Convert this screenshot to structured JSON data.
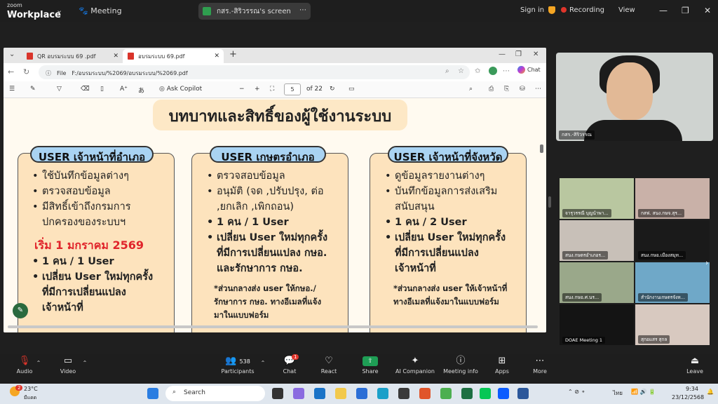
{
  "zoom": {
    "brand_small": "zoom",
    "brand": "Workplace",
    "meeting": "Meeting",
    "share_title": "กสร.-สิริวรรณ's screen",
    "sign_in": "Sign in",
    "recording": "Recording",
    "view": "View"
  },
  "browser": {
    "tabs": [
      {
        "label": "QR อบรมระบบ 69 .pdf"
      },
      {
        "label": "อบรมระบบ 69.pdf"
      }
    ],
    "file_label": "File",
    "url": "F:/อบรมระบบ/%2069/อบรมระบบ/%2069.pdf",
    "chat": "Chat",
    "ask_copilot": "Ask Copilot",
    "page_current": "5",
    "page_total": "of 22"
  },
  "slide": {
    "title": "บทบาทและสิทธิ์ของผู้ใช้งานระบบ",
    "col1": {
      "heading": "USER เจ้าหน้าที่อำเภอ",
      "items": [
        "ใช้บันทึกข้อมูลต่างๆ",
        "ตรวจสอบข้อมูล",
        "มีสิทธิ์เข้าถึงกรมการ",
        "ปกครองของระบบฯ"
      ],
      "start": "เริ่ม 1 มกราคม 2569",
      "bold": [
        "1 คน / 1 User",
        "เปลี่ยน User ใหม่ทุกครั้ง",
        "ที่มีการเปลี่ยนแปลง",
        "เจ้าหน้าที่"
      ]
    },
    "col2": {
      "heading": "USER เกษตรอำเภอ",
      "items": [
        "ตรวจสอบข้อมูล",
        "อนุมัติ (จด ,ปรับปรุง, ต่อ",
        ",ยกเลิก ,เพิกถอน)"
      ],
      "bold": [
        "1 คน / 1 User",
        "เปลี่ยน User ใหม่ทุกครั้ง",
        "ที่มีการเปลี่ยนแปลง กษอ.",
        "และรักษาการ กษอ."
      ],
      "note": [
        "*ส่วนกลางส่ง user ให้กษอ./",
        "รักษาการ กษอ. ทางอีเมลที่แจ้ง",
        "มาในแบบฟอร์ม"
      ]
    },
    "col3": {
      "heading": "USER เจ้าหน้าที่จังหวัด",
      "items": [
        "ดูข้อมูลรายงานต่างๆ",
        "บันทึกข้อมูลการส่งเสริม",
        "สนับสนุน"
      ],
      "bold": [
        "1 คน / 2 User",
        "เปลี่ยน User ใหม่ทุกครั้ง",
        "ที่มีการเปลี่ยนแปลง",
        "เจ้าหน้าที่"
      ],
      "note": [
        "*ส่วนกลางส่ง user ให้เจ้าหน้าที่",
        "ทางอีเมลที่แจ้งมาในแบบฟอร์ม"
      ]
    }
  },
  "participants_video": {
    "main": "กสร.-สิริวรรณ",
    "tiles": [
      "จารุวรรณี บุญนำพา...",
      "กสฟ. สนง.กษจ.สุร...",
      "",
      "",
      "สนง.กษตรอำเภอร...",
      "สนง.กษอ.เมืองสมุท...",
      "สนง.กษอ.ศ.นร...",
      "สำนักงานเกษตรจังห...",
      "DOAE Meeting 1",
      "สุกอแสร สุกล"
    ]
  },
  "controls": {
    "audio": "Audio",
    "video": "Video",
    "participants": "Participants",
    "participants_count": "538",
    "chat": "Chat",
    "chat_badge": "1",
    "react": "React",
    "share": "Share",
    "ai": "AI Companion",
    "info": "Meeting info",
    "apps": "Apps",
    "more": "More",
    "leave": "Leave"
  },
  "taskbar": {
    "temp": "23°C",
    "weather": "มีแดด",
    "search": "Search",
    "lang": "ไทย",
    "time": "9:34",
    "date": "23/12/2568",
    "weather_badge": "2"
  }
}
